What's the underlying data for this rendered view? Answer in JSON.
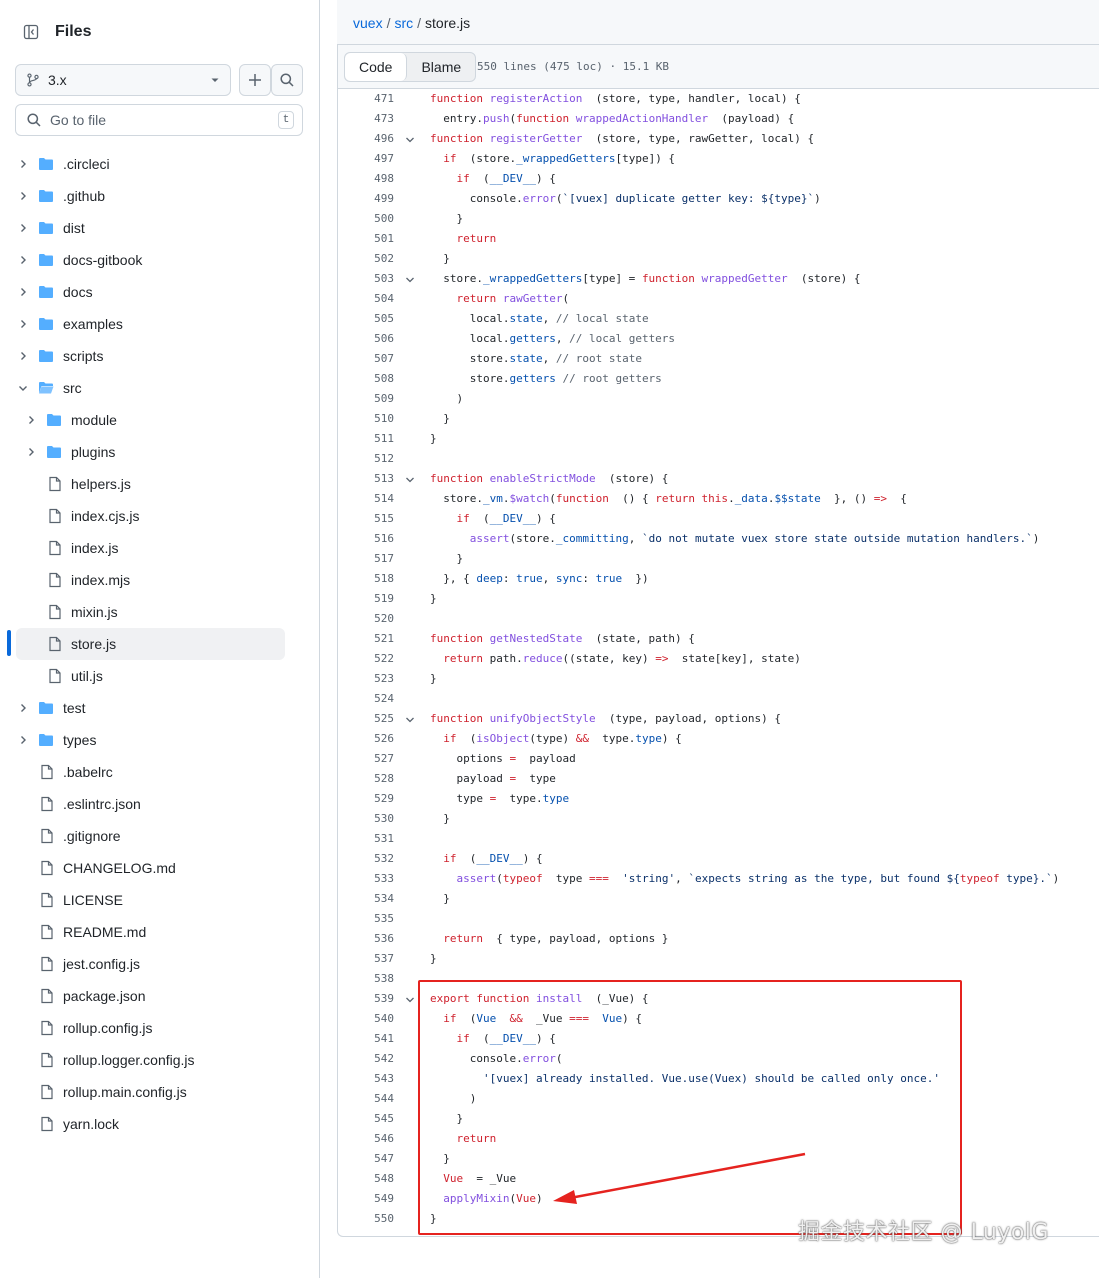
{
  "sidebar": {
    "title": "Files",
    "branch": "3.x",
    "search_placeholder": "Go to file",
    "search_shortcut": "t",
    "selected": "store.js",
    "tree": [
      {
        "name": ".circleci",
        "type": "folder",
        "depth": 0,
        "expanded": false
      },
      {
        "name": ".github",
        "type": "folder",
        "depth": 0,
        "expanded": false
      },
      {
        "name": "dist",
        "type": "folder",
        "depth": 0,
        "expanded": false
      },
      {
        "name": "docs-gitbook",
        "type": "folder",
        "depth": 0,
        "expanded": false
      },
      {
        "name": "docs",
        "type": "folder",
        "depth": 0,
        "expanded": false
      },
      {
        "name": "examples",
        "type": "folder",
        "depth": 0,
        "expanded": false
      },
      {
        "name": "scripts",
        "type": "folder",
        "depth": 0,
        "expanded": false
      },
      {
        "name": "src",
        "type": "folder",
        "depth": 0,
        "expanded": true
      },
      {
        "name": "module",
        "type": "folder",
        "depth": 1,
        "expanded": false
      },
      {
        "name": "plugins",
        "type": "folder",
        "depth": 1,
        "expanded": false
      },
      {
        "name": "helpers.js",
        "type": "file",
        "depth": 1
      },
      {
        "name": "index.cjs.js",
        "type": "file",
        "depth": 1
      },
      {
        "name": "index.js",
        "type": "file",
        "depth": 1
      },
      {
        "name": "index.mjs",
        "type": "file",
        "depth": 1
      },
      {
        "name": "mixin.js",
        "type": "file",
        "depth": 1
      },
      {
        "name": "store.js",
        "type": "file",
        "depth": 1
      },
      {
        "name": "util.js",
        "type": "file",
        "depth": 1
      },
      {
        "name": "test",
        "type": "folder",
        "depth": 0,
        "expanded": false
      },
      {
        "name": "types",
        "type": "folder",
        "depth": 0,
        "expanded": false
      },
      {
        "name": ".babelrc",
        "type": "file",
        "depth": 0
      },
      {
        "name": ".eslintrc.json",
        "type": "file",
        "depth": 0
      },
      {
        "name": ".gitignore",
        "type": "file",
        "depth": 0
      },
      {
        "name": "CHANGELOG.md",
        "type": "file",
        "depth": 0
      },
      {
        "name": "LICENSE",
        "type": "file",
        "depth": 0
      },
      {
        "name": "README.md",
        "type": "file",
        "depth": 0
      },
      {
        "name": "jest.config.js",
        "type": "file",
        "depth": 0
      },
      {
        "name": "package.json",
        "type": "file",
        "depth": 0
      },
      {
        "name": "rollup.config.js",
        "type": "file",
        "depth": 0
      },
      {
        "name": "rollup.logger.config.js",
        "type": "file",
        "depth": 0
      },
      {
        "name": "rollup.main.config.js",
        "type": "file",
        "depth": 0
      },
      {
        "name": "yarn.lock",
        "type": "file",
        "depth": 0
      }
    ]
  },
  "breadcrumb": {
    "repo": "vuex",
    "sep1": "/",
    "dir": "src",
    "sep2": "/",
    "file": "store.js"
  },
  "file_header": {
    "code_tab": "Code",
    "blame_tab": "Blame",
    "info": "550 lines (475 loc) · 15.1 KB"
  },
  "code_lines": [
    {
      "n": "471",
      "fold": false,
      "t": [
        [
          "kw",
          "function "
        ],
        [
          "fn",
          "registerAction"
        ],
        [
          "",
          "  (store, type, handler, local) {"
        ]
      ]
    },
    {
      "n": "473",
      "fold": false,
      "t": [
        [
          "",
          "  entry."
        ],
        [
          "fn",
          "push"
        ],
        [
          "",
          "("
        ],
        [
          "kw",
          "function "
        ],
        [
          "fn",
          "wrappedActionHandler"
        ],
        [
          "",
          "  (payload) {"
        ]
      ]
    },
    {
      "n": "496",
      "fold": true,
      "t": [
        [
          "kw",
          "function "
        ],
        [
          "fn",
          "registerGetter"
        ],
        [
          "",
          "  (store, type, rawGetter, local) {"
        ]
      ]
    },
    {
      "n": "497",
      "fold": false,
      "t": [
        [
          "",
          "  "
        ],
        [
          "kw",
          "if"
        ],
        [
          "",
          "  (store."
        ],
        [
          "pr",
          "_wrappedGetters"
        ],
        [
          "",
          "[type]) {"
        ]
      ]
    },
    {
      "n": "498",
      "fold": false,
      "t": [
        [
          "",
          "    "
        ],
        [
          "kw",
          "if"
        ],
        [
          "",
          "  ("
        ],
        [
          "pr",
          "__DEV__"
        ],
        [
          "",
          ") {"
        ]
      ]
    },
    {
      "n": "499",
      "fold": false,
      "t": [
        [
          "",
          "      console."
        ],
        [
          "fn",
          "error"
        ],
        [
          "",
          "("
        ],
        [
          "st",
          "`[vuex] duplicate getter key: ${type}`"
        ],
        [
          "",
          ")"
        ]
      ]
    },
    {
      "n": "500",
      "fold": false,
      "t": [
        [
          "",
          "    }"
        ]
      ]
    },
    {
      "n": "501",
      "fold": false,
      "t": [
        [
          "",
          "    "
        ],
        [
          "kw",
          "return"
        ]
      ]
    },
    {
      "n": "502",
      "fold": false,
      "t": [
        [
          "",
          "  }"
        ]
      ]
    },
    {
      "n": "503",
      "fold": true,
      "t": [
        [
          "",
          "  store."
        ],
        [
          "pr",
          "_wrappedGetters"
        ],
        [
          "",
          "[type] = "
        ],
        [
          "kw",
          "function "
        ],
        [
          "fn",
          "wrappedGetter"
        ],
        [
          "",
          "  (store) {"
        ]
      ]
    },
    {
      "n": "504",
      "fold": false,
      "t": [
        [
          "",
          "    "
        ],
        [
          "kw",
          "return "
        ],
        [
          "fn",
          "rawGetter"
        ],
        [
          "",
          "("
        ]
      ]
    },
    {
      "n": "505",
      "fold": false,
      "t": [
        [
          "",
          "      local."
        ],
        [
          "pr",
          "state"
        ],
        [
          "",
          ", "
        ],
        [
          "cm",
          "// local state"
        ]
      ]
    },
    {
      "n": "506",
      "fold": false,
      "t": [
        [
          "",
          "      local."
        ],
        [
          "pr",
          "getters"
        ],
        [
          "",
          ", "
        ],
        [
          "cm",
          "// local getters"
        ]
      ]
    },
    {
      "n": "507",
      "fold": false,
      "t": [
        [
          "",
          "      store."
        ],
        [
          "pr",
          "state"
        ],
        [
          "",
          ", "
        ],
        [
          "cm",
          "// root state"
        ]
      ]
    },
    {
      "n": "508",
      "fold": false,
      "t": [
        [
          "",
          "      store."
        ],
        [
          "pr",
          "getters "
        ],
        [
          "cm",
          "// root getters"
        ]
      ]
    },
    {
      "n": "509",
      "fold": false,
      "t": [
        [
          "",
          "    )"
        ]
      ]
    },
    {
      "n": "510",
      "fold": false,
      "t": [
        [
          "",
          "  }"
        ]
      ]
    },
    {
      "n": "511",
      "fold": false,
      "t": [
        [
          "",
          "}"
        ]
      ]
    },
    {
      "n": "512",
      "fold": false,
      "t": []
    },
    {
      "n": "513",
      "fold": true,
      "t": [
        [
          "kw",
          "function "
        ],
        [
          "fn",
          "enableStrictMode"
        ],
        [
          "",
          "  (store) {"
        ]
      ]
    },
    {
      "n": "514",
      "fold": false,
      "t": [
        [
          "",
          "  store."
        ],
        [
          "pr",
          "_vm"
        ],
        [
          "",
          "."
        ],
        [
          "fn",
          "$watch"
        ],
        [
          "",
          "("
        ],
        [
          "kw",
          "function"
        ],
        [
          "",
          "  () { "
        ],
        [
          "kw",
          "return this"
        ],
        [
          "",
          "."
        ],
        [
          "pr",
          "_data"
        ],
        [
          "",
          "."
        ],
        [
          "pr",
          "$$state"
        ],
        [
          "",
          "  }, () "
        ],
        [
          "kw",
          "=>"
        ],
        [
          "",
          "  {"
        ]
      ]
    },
    {
      "n": "515",
      "fold": false,
      "t": [
        [
          "",
          "    "
        ],
        [
          "kw",
          "if"
        ],
        [
          "",
          "  ("
        ],
        [
          "pr",
          "__DEV__"
        ],
        [
          "",
          ") {"
        ]
      ]
    },
    {
      "n": "516",
      "fold": false,
      "t": [
        [
          "",
          "      "
        ],
        [
          "fn",
          "assert"
        ],
        [
          "",
          "(store."
        ],
        [
          "pr",
          "_committing"
        ],
        [
          "",
          ", "
        ],
        [
          "st",
          "`do not mutate vuex store state outside mutation handlers.`"
        ],
        [
          "",
          ")"
        ]
      ]
    },
    {
      "n": "517",
      "fold": false,
      "t": [
        [
          "",
          "    }"
        ]
      ]
    },
    {
      "n": "518",
      "fold": false,
      "t": [
        [
          "",
          "  }, { "
        ],
        [
          "pr",
          "deep"
        ],
        [
          "",
          ": "
        ],
        [
          "pr",
          "true"
        ],
        [
          "",
          ", "
        ],
        [
          "pr",
          "sync"
        ],
        [
          "",
          ": "
        ],
        [
          "pr",
          "true"
        ],
        [
          "",
          "  })"
        ]
      ]
    },
    {
      "n": "519",
      "fold": false,
      "t": [
        [
          "",
          "}"
        ]
      ]
    },
    {
      "n": "520",
      "fold": false,
      "t": []
    },
    {
      "n": "521",
      "fold": false,
      "t": [
        [
          "kw",
          "function "
        ],
        [
          "fn",
          "getNestedState"
        ],
        [
          "",
          "  (state, path) {"
        ]
      ]
    },
    {
      "n": "522",
      "fold": false,
      "t": [
        [
          "",
          "  "
        ],
        [
          "kw",
          "return "
        ],
        [
          "",
          "path."
        ],
        [
          "fn",
          "reduce"
        ],
        [
          "",
          "((state, key) "
        ],
        [
          "kw",
          "=>"
        ],
        [
          "",
          "  state[key], state)"
        ]
      ]
    },
    {
      "n": "523",
      "fold": false,
      "t": [
        [
          "",
          "}"
        ]
      ]
    },
    {
      "n": "524",
      "fold": false,
      "t": []
    },
    {
      "n": "525",
      "fold": true,
      "t": [
        [
          "kw",
          "function "
        ],
        [
          "fn",
          "unifyObjectStyle"
        ],
        [
          "",
          "  (type, payload, options) {"
        ]
      ]
    },
    {
      "n": "526",
      "fold": false,
      "t": [
        [
          "",
          "  "
        ],
        [
          "kw",
          "if"
        ],
        [
          "",
          "  ("
        ],
        [
          "fn",
          "isObject"
        ],
        [
          "",
          "(type) "
        ],
        [
          "kw",
          "&&"
        ],
        [
          "",
          "  type."
        ],
        [
          "pr",
          "type"
        ],
        [
          "",
          ") {"
        ]
      ]
    },
    {
      "n": "527",
      "fold": false,
      "t": [
        [
          "",
          "    options "
        ],
        [
          "kw",
          "="
        ],
        [
          "",
          "  payload"
        ]
      ]
    },
    {
      "n": "528",
      "fold": false,
      "t": [
        [
          "",
          "    payload "
        ],
        [
          "kw",
          "="
        ],
        [
          "",
          "  type"
        ]
      ]
    },
    {
      "n": "529",
      "fold": false,
      "t": [
        [
          "",
          "    type "
        ],
        [
          "kw",
          "="
        ],
        [
          "",
          "  type."
        ],
        [
          "pr",
          "type"
        ]
      ]
    },
    {
      "n": "530",
      "fold": false,
      "t": [
        [
          "",
          "  }"
        ]
      ]
    },
    {
      "n": "531",
      "fold": false,
      "t": []
    },
    {
      "n": "532",
      "fold": false,
      "t": [
        [
          "",
          "  "
        ],
        [
          "kw",
          "if"
        ],
        [
          "",
          "  ("
        ],
        [
          "pr",
          "__DEV__"
        ],
        [
          "",
          ") {"
        ]
      ]
    },
    {
      "n": "533",
      "fold": false,
      "t": [
        [
          "",
          "    "
        ],
        [
          "fn",
          "assert"
        ],
        [
          "",
          "("
        ],
        [
          "kw",
          "typeof"
        ],
        [
          "",
          "  type "
        ],
        [
          "kw",
          "==="
        ],
        [
          "",
          "  "
        ],
        [
          "st",
          "'string'"
        ],
        [
          "",
          ", "
        ],
        [
          "st",
          "`expects string as the type, but found ${"
        ],
        [
          "kw",
          "typeof"
        ],
        [
          "st",
          " type}.`"
        ],
        [
          "",
          ")"
        ]
      ]
    },
    {
      "n": "534",
      "fold": false,
      "t": [
        [
          "",
          "  }"
        ]
      ]
    },
    {
      "n": "535",
      "fold": false,
      "t": []
    },
    {
      "n": "536",
      "fold": false,
      "t": [
        [
          "",
          "  "
        ],
        [
          "kw",
          "return"
        ],
        [
          "",
          "  { type, payload, options }"
        ]
      ]
    },
    {
      "n": "537",
      "fold": false,
      "t": [
        [
          "",
          "}"
        ]
      ]
    },
    {
      "n": "538",
      "fold": false,
      "t": []
    },
    {
      "n": "539",
      "fold": true,
      "t": [
        [
          "kw",
          "export function "
        ],
        [
          "fn",
          "install"
        ],
        [
          "",
          "  (_Vue) {"
        ]
      ]
    },
    {
      "n": "540",
      "fold": false,
      "t": [
        [
          "",
          "  "
        ],
        [
          "kw",
          "if"
        ],
        [
          "",
          "  ("
        ],
        [
          "pr",
          "Vue"
        ],
        [
          "",
          "  "
        ],
        [
          "kw",
          "&&"
        ],
        [
          "",
          "  _Vue "
        ],
        [
          "kw",
          "==="
        ],
        [
          "",
          "  "
        ],
        [
          "pr",
          "Vue"
        ],
        [
          "",
          ") {"
        ]
      ]
    },
    {
      "n": "541",
      "fold": false,
      "t": [
        [
          "",
          "    "
        ],
        [
          "kw",
          "if"
        ],
        [
          "",
          "  ("
        ],
        [
          "pr",
          "__DEV__"
        ],
        [
          "",
          ") {"
        ]
      ]
    },
    {
      "n": "542",
      "fold": false,
      "t": [
        [
          "",
          "      console."
        ],
        [
          "fn",
          "error"
        ],
        [
          "",
          "("
        ]
      ]
    },
    {
      "n": "543",
      "fold": false,
      "t": [
        [
          "",
          "        "
        ],
        [
          "st",
          "'[vuex] already installed. Vue.use(Vuex) should be called only once.'"
        ]
      ]
    },
    {
      "n": "544",
      "fold": false,
      "t": [
        [
          "",
          "      )"
        ]
      ]
    },
    {
      "n": "545",
      "fold": false,
      "t": [
        [
          "",
          "    }"
        ]
      ]
    },
    {
      "n": "546",
      "fold": false,
      "t": [
        [
          "",
          "    "
        ],
        [
          "kw",
          "return"
        ]
      ]
    },
    {
      "n": "547",
      "fold": false,
      "t": [
        [
          "",
          "  }"
        ]
      ]
    },
    {
      "n": "548",
      "fold": false,
      "t": [
        [
          "",
          "  "
        ],
        [
          "kw",
          "Vue"
        ],
        [
          "",
          "  = _Vue"
        ]
      ]
    },
    {
      "n": "549",
      "fold": false,
      "t": [
        [
          "",
          "  "
        ],
        [
          "fn",
          "applyMixin"
        ],
        [
          "",
          "("
        ],
        [
          "kw",
          "Vue"
        ],
        [
          "",
          ")"
        ]
      ]
    },
    {
      "n": "550",
      "fold": false,
      "t": [
        [
          "",
          "}"
        ]
      ]
    }
  ],
  "watermark": "掘金技术社区 @ LuyolG",
  "colors": {
    "accent": "#0969da",
    "folder": "#54aeff",
    "highlight": "#e5231f"
  }
}
